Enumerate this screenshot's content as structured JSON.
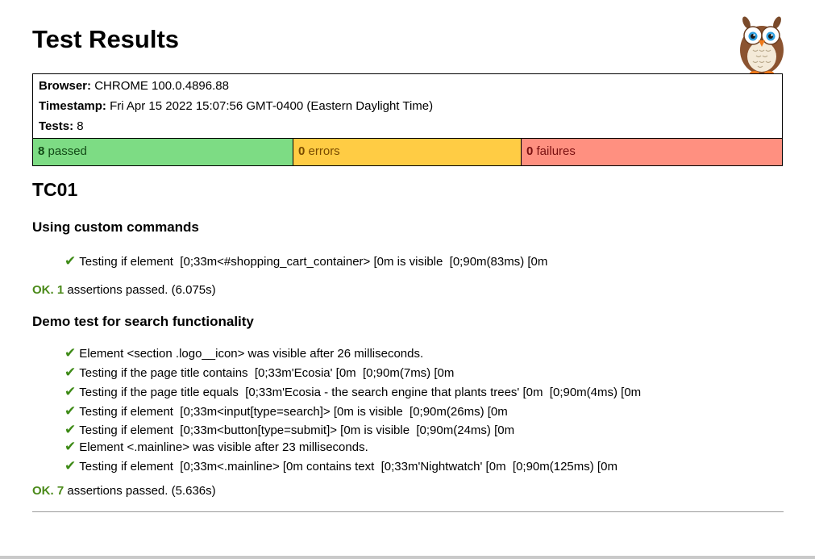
{
  "page_title": "Test Results",
  "summary": {
    "browser_label": "Browser:",
    "browser_value": "CHROME 100.0.4896.88",
    "timestamp_label": "Timestamp:",
    "timestamp_value": "Fri Apr 15 2022 15:07:56 GMT-0400 (Eastern Daylight Time)",
    "tests_label": "Tests:",
    "tests_value": "8",
    "passed_count": "8",
    "passed_label": "passed",
    "errors_count": "0",
    "errors_label": "errors",
    "failures_count": "0",
    "failures_label": "failures"
  },
  "module": {
    "name": "TC01",
    "tests": [
      {
        "title": "Using custom commands",
        "assertions": [
          "Testing if element  [0;33m<#shopping_cart_container> [0m is visible  [0;90m(83ms) [0m"
        ],
        "ok_label": "OK. 1",
        "result_text": " assertions passed. (6.075s)"
      },
      {
        "title": "Demo test for search functionality",
        "assertions": [
          "Element <section .logo__icon> was visible after 26 milliseconds.",
          "Testing if the page title contains  [0;33m'Ecosia' [0m  [0;90m(7ms) [0m",
          "Testing if the page title equals  [0;33m'Ecosia - the search engine that plants trees' [0m  [0;90m(4ms) [0m",
          "Testing if element  [0;33m<input[type=search]> [0m is visible  [0;90m(26ms) [0m",
          "Testing if element  [0;33m<button[type=submit]> [0m is visible  [0;90m(24ms) [0m",
          "Element <.mainline> was visible after 23 milliseconds.",
          "Testing if element  [0;33m<.mainline> [0m contains text  [0;33m'Nightwatch' [0m  [0;90m(125ms) [0m"
        ],
        "ok_label": "OK. 7",
        "result_text": " assertions passed. (5.636s)"
      }
    ]
  },
  "check_glyph": "✔",
  "colors": {
    "passed_bg": "#7ddc84",
    "errors_bg": "#ffcc44",
    "failures_bg": "#ff9080",
    "ok_text": "#4b8a1a",
    "check": "#3d8a16"
  },
  "icons": {
    "logo": "owl-icon"
  }
}
